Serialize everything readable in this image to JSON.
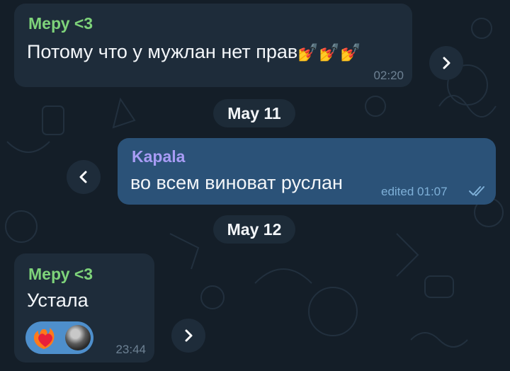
{
  "colors": {
    "background": "#141e28",
    "incoming_bubble": "#1e2c3a",
    "outgoing_bubble": "#2b5278",
    "sender_green": "#7ed37a",
    "sender_purple": "#a89cf5",
    "reaction_bg": "#4e8fcc"
  },
  "messages": [
    {
      "sender": "Мeру <3",
      "text": "Потому что у мужлан нет прав",
      "emoji": "💅💅💅",
      "time": "02:20",
      "direction": "incoming"
    },
    {
      "sender": "Kapala",
      "text": "во всем виноват руслан",
      "time": "edited 01:07",
      "direction": "outgoing",
      "status_icon": "double-check-icon"
    },
    {
      "sender": "Мeру <3",
      "text": "Устала",
      "time": "23:44",
      "direction": "incoming",
      "reactions": [
        "heart-on-fire-icon",
        "user-avatar"
      ]
    }
  ],
  "date_separators": [
    "May 11",
    "May 12"
  ],
  "icons": {
    "forward": "chevron-right-icon",
    "reply": "chevron-left-icon"
  }
}
